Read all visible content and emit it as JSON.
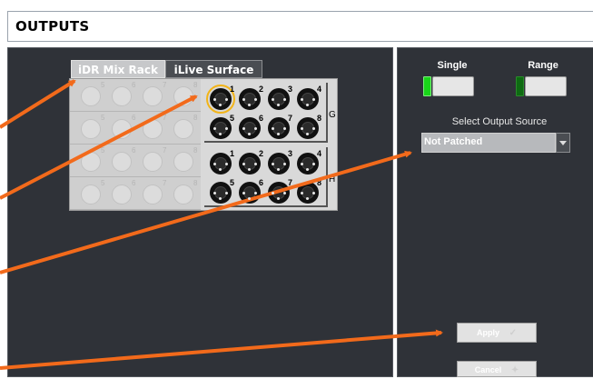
{
  "window": {
    "title": "OUTPUTS"
  },
  "tabs": [
    {
      "label": "iDR Mix Rack",
      "active": true
    },
    {
      "label": "iLive Surface",
      "active": false
    }
  ],
  "ghost_rack": {
    "rows": [
      {
        "numbers": [
          "5",
          "6",
          "7",
          "8"
        ]
      },
      {
        "numbers": [
          "5",
          "6",
          "7",
          "8"
        ]
      },
      {
        "numbers": [
          "5",
          "6",
          "7",
          "8"
        ]
      },
      {
        "numbers": [
          "5",
          "6",
          "7",
          "8"
        ]
      }
    ]
  },
  "port_groups": [
    {
      "letter": "G",
      "top_numbers": [
        "1",
        "2",
        "3",
        "4"
      ],
      "bottom_numbers": [
        "5",
        "6",
        "7",
        "8"
      ],
      "selected_port": "1"
    },
    {
      "letter": "H",
      "top_numbers": [
        "1",
        "2",
        "3",
        "4"
      ],
      "bottom_numbers": [
        "5",
        "6",
        "7",
        "8"
      ]
    }
  ],
  "mode": {
    "single_label": "Single",
    "range_label": "Range",
    "single_active": true,
    "colors": {
      "active_led": "#19d619",
      "inactive_led": "#0e6b12"
    }
  },
  "output_source": {
    "label": "Select Output Source",
    "value": "Not Patched"
  },
  "actions": {
    "apply_label": "Apply",
    "cancel_label": "Cancel",
    "apply_icon": "checkmark-icon",
    "cancel_icon": "cross-sparkle-icon"
  },
  "colors": {
    "panel_bg": "#2f3238",
    "selection_outline": "#f2b418",
    "annotation_arrow": "#f26a1b"
  }
}
